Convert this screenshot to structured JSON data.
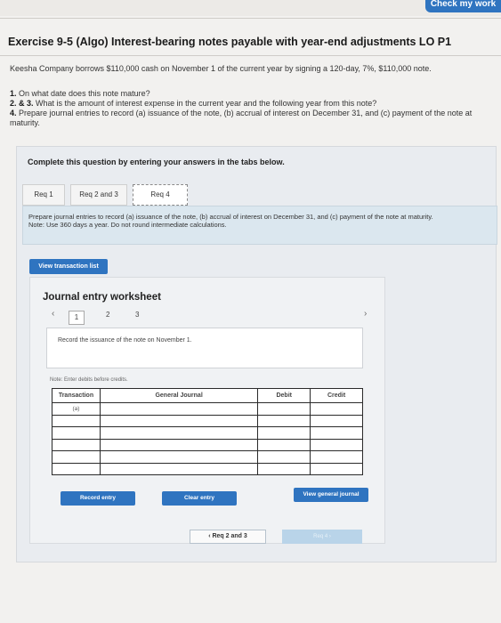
{
  "header": {
    "check_button": "Check my work"
  },
  "exercise": {
    "title": "Exercise 9-5 (Algo) Interest-bearing notes payable with year-end adjustments LO P1",
    "intro": "Keesha Company borrows $110,000 cash on November 1 of the current year by signing a 120-day, 7%, $110,000 note.",
    "questions": [
      {
        "num": "1.",
        "text": " On what date does this note mature?"
      },
      {
        "num": "2. & 3.",
        "text": " What is the amount of interest expense in the current year and the following year from this note?"
      },
      {
        "num": "4.",
        "text": " Prepare journal entries to record (a) issuance of the note, (b) accrual of interest on December 31, and (c) payment of the note at maturity."
      }
    ]
  },
  "panel": {
    "heading": "Complete this question by entering your answers in the tabs below.",
    "tabs": [
      "Req 1",
      "Req 2 and 3",
      "Req 4"
    ],
    "requirement_text": "Prepare journal entries to record (a) issuance of the note, (b) accrual of interest on December 31, and (c) payment of the note at maturity.",
    "requirement_note": "Note: Use 360 days a year. Do not round intermediate calculations.",
    "view_transaction_list": "View transaction list"
  },
  "worksheet": {
    "title": "Journal entry worksheet",
    "pages": [
      "1",
      "2",
      "3"
    ],
    "record_prompt": "Record the issuance of the note on November 1.",
    "note": "Note: Enter debits before credits.",
    "columns": [
      "Transaction",
      "General Journal",
      "Debit",
      "Credit"
    ],
    "rows": [
      [
        "(a)",
        "",
        "",
        ""
      ],
      [
        "",
        "",
        "",
        ""
      ],
      [
        "",
        "",
        "",
        ""
      ],
      [
        "",
        "",
        "",
        ""
      ],
      [
        "",
        "",
        "",
        ""
      ],
      [
        "",
        "",
        "",
        ""
      ]
    ],
    "record_entry": "Record entry",
    "clear_entry": "Clear entry",
    "view_general_journal": "View general journal"
  },
  "navigation": {
    "prev": "‹  Req 2 and 3",
    "next": "Req 4  ›"
  }
}
